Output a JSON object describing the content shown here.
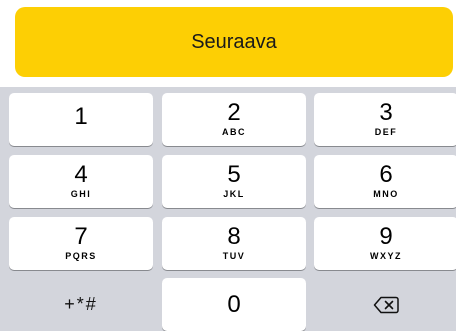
{
  "next_button": {
    "label": "Seuraava"
  },
  "keys": [
    {
      "digit": "1",
      "letters": ""
    },
    {
      "digit": "2",
      "letters": "ABC"
    },
    {
      "digit": "3",
      "letters": "DEF"
    },
    {
      "digit": "4",
      "letters": "GHI"
    },
    {
      "digit": "5",
      "letters": "JKL"
    },
    {
      "digit": "6",
      "letters": "MNO"
    },
    {
      "digit": "7",
      "letters": "PQRS"
    },
    {
      "digit": "8",
      "letters": "TUV"
    },
    {
      "digit": "9",
      "letters": "WXYZ"
    },
    {
      "digit": "0",
      "letters": ""
    }
  ],
  "symbols_key": {
    "label": "+*#"
  },
  "backspace_key": {
    "icon": "backspace-icon"
  },
  "colors": {
    "accent": "#fdcf04",
    "keypad_bg": "#d3d5dc",
    "key_bg": "#ffffff"
  }
}
